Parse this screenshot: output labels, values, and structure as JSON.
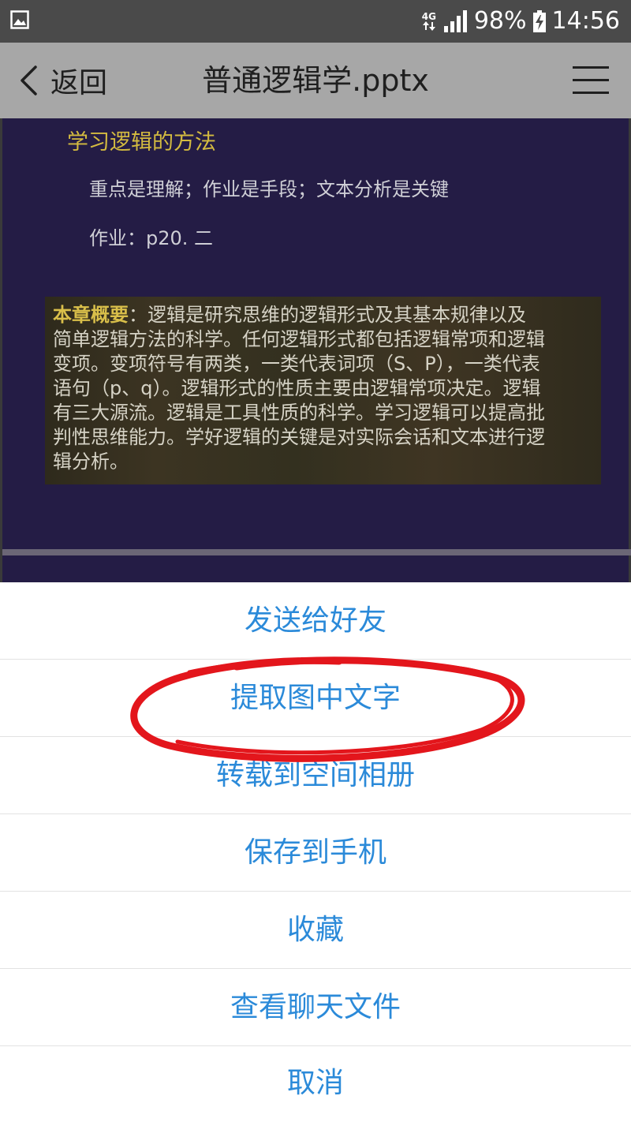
{
  "status_bar": {
    "network": "4G",
    "battery": "98%",
    "time": "14:56"
  },
  "top_bar": {
    "back_label": "返回",
    "title": "普通逻辑学.pptx"
  },
  "slide": {
    "heading": "学习逻辑的方法",
    "line1": "重点是理解；作业是手段；文本分析是关键",
    "line2": "作业：p20. 二",
    "summary_label": "本章概要",
    "summary_lines": [
      "：逻辑是研究思维的逻辑形式及其基本规律以及",
      "简单逻辑方法的科学。任何逻辑形式都包括逻辑常项和逻辑",
      "变项。变项符号有两类，一类代表词项（S、P），一类代表",
      "语句（p、q）。逻辑形式的性质主要由逻辑常项决定。逻辑",
      "有三大源流。逻辑是工具性质的科学。学习逻辑可以提高批",
      "判性思维能力。学好逻辑的关键是对实际会话和文本进行逻",
      "辑分析。"
    ]
  },
  "action_sheet": {
    "items": [
      "发送给好友",
      "提取图中文字",
      "转载到空间相册",
      "保存到手机",
      "收藏",
      "查看聊天文件",
      "取消"
    ],
    "highlighted_index": 1
  },
  "colors": {
    "action_text": "#2b8ad9",
    "slide_bg": "#241c45",
    "heading": "#d4bb40",
    "annotation": "#e3161c"
  }
}
